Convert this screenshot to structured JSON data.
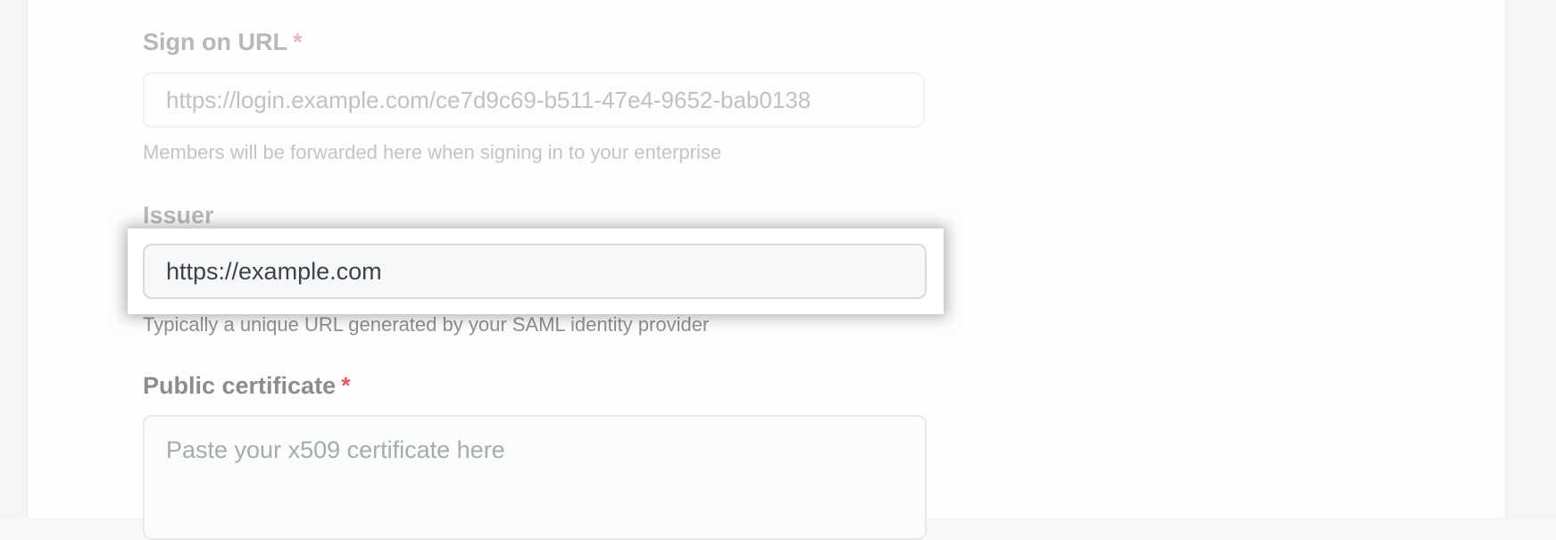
{
  "form": {
    "sign_on_url": {
      "label": "Sign on URL",
      "required_marker": "*",
      "value": "https://login.example.com/ce7d9c69-b511-47e4-9652-bab0138",
      "hint": "Members will be forwarded here when signing in to your enterprise"
    },
    "issuer": {
      "label": "Issuer",
      "value": "https://example.com",
      "hint": "Typically a unique URL generated by your SAML identity provider"
    },
    "public_certificate": {
      "label": "Public certificate",
      "required_marker": "*",
      "placeholder": "Paste your x509 certificate here"
    }
  }
}
